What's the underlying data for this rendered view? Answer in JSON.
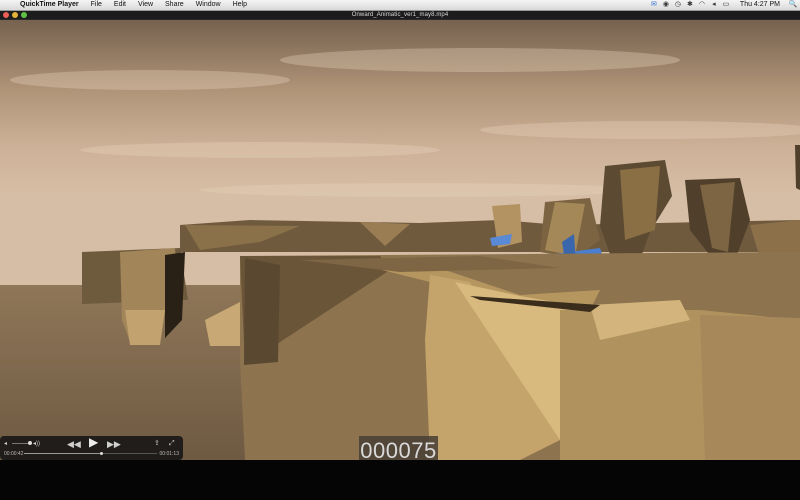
{
  "menubar": {
    "apple_icon": "",
    "menus": [
      "QuickTime Player",
      "File",
      "Edit",
      "View",
      "Share",
      "Window",
      "Help"
    ],
    "status_icons": [
      "mail-icon",
      "volume-icon",
      "timemachine-icon",
      "bluetooth-icon",
      "wifi-icon",
      "sound-icon",
      "battery-icon"
    ],
    "clock": "Thu 4:27 PM",
    "spotlight_icon": "🔍"
  },
  "window": {
    "title": "Onward_Animatic_ver1_may8.mp4"
  },
  "video": {
    "frame_counter": "000075"
  },
  "controller": {
    "vol_down_glyph": "◂",
    "vol_up_glyph": "◂))",
    "rewind_glyph": "◀◀",
    "play_glyph": "▶",
    "ffwd_glyph": "▶▶",
    "share_glyph": "⇪",
    "expand_glyph": "⤢",
    "elapsed": "00:00:42",
    "remaining": "00:01:13",
    "progress": 0.58,
    "volume": 1.0
  },
  "colors": {
    "sky_top": "#7d6a58",
    "sky_mid": "#c9ad92",
    "ground": "#8a7255",
    "plane": "#4a7fd0"
  }
}
